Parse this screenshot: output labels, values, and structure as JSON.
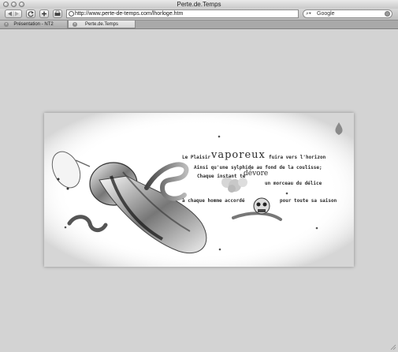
{
  "window": {
    "title": "Perte.de.Temps"
  },
  "toolbar": {
    "back_icon": "back-arrow-icon",
    "forward_icon": "forward-arrow-icon",
    "reload_icon": "reload-icon",
    "add_bookmark_icon": "plus-icon",
    "print_icon": "printer-icon",
    "url": "http://www.perte-de-temps.com/lhorloge.htm",
    "search_placeholder": "Google",
    "search_icon": "magnifier-icon",
    "snapback_icon": "snapback-icon"
  },
  "tabs": [
    {
      "label": "Présentation - NT2",
      "active": false
    },
    {
      "label": "Perte.de.Temps",
      "active": true
    }
  ],
  "poem": {
    "line1a": "Le Plaisir",
    "line1b": "vaporeux",
    "line1c": "fuira vers l'horizon",
    "line2": "Ainsi qu'une sylphide au fond de la coulisse;",
    "line3a": "Chaque instant te",
    "line3b": "dévore",
    "line4": "un morceau du délice",
    "line5a": "à chaque homme accordé",
    "line5b": "pour toute sa saison"
  },
  "colors": {
    "background": "#d3d3d3",
    "card": "#ffffff",
    "chrome": "#c9c9c9"
  }
}
